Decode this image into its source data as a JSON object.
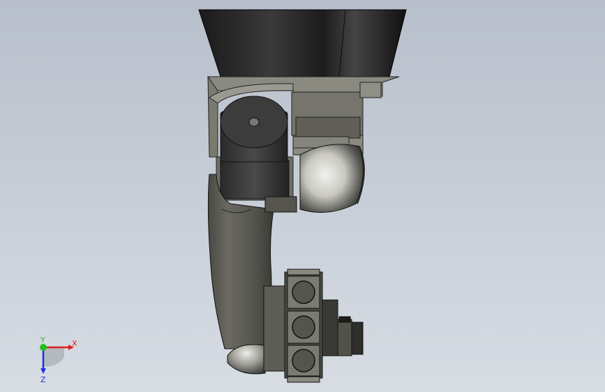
{
  "viewport": {
    "background_top": "#b7bfcb",
    "background_bottom": "#d8dde4"
  },
  "model": {
    "parts": [
      "base-cone",
      "upper-housing",
      "motor-cylinder",
      "shoulder-cover",
      "upper-arm",
      "wrist-gearbox",
      "tool-flange"
    ]
  },
  "triad": {
    "x_label": "X",
    "y_label": "Y",
    "z_label": "Z",
    "x_color": "#e02020",
    "y_color": "#20c020",
    "z_color": "#2030e0"
  }
}
